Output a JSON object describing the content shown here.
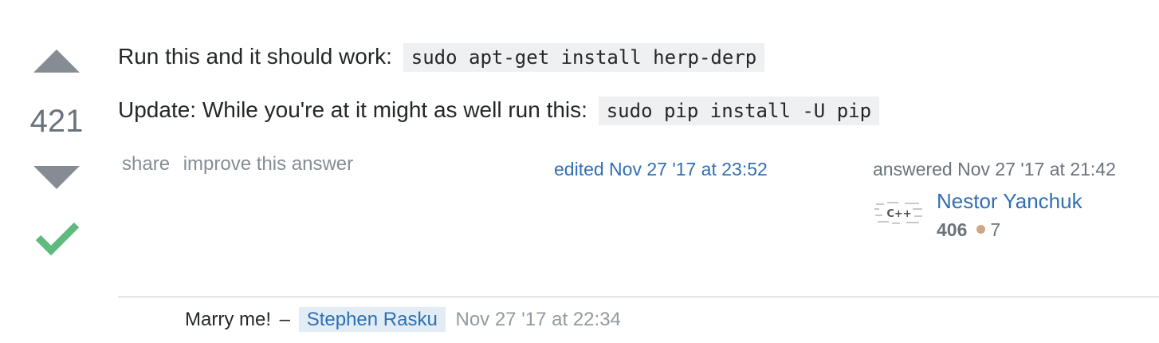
{
  "vote": {
    "count": "421",
    "up_icon": "triangle-up-icon",
    "down_icon": "triangle-down-icon",
    "accepted_icon": "checkmark-icon",
    "accepted_color": "#5fba7d"
  },
  "post": {
    "line1_text": "Run this and it should work:",
    "line1_code": "sudo apt-get install herp-derp",
    "line2_text": "Update: While you're at it might as well run this:",
    "line2_code": "sudo pip install -U pip"
  },
  "menu": {
    "share_label": "share",
    "improve_label": "improve this answer"
  },
  "edited": {
    "label": "edited Nov 27 '17 at 23:52"
  },
  "user": {
    "action": "answered Nov 27 '17 at 21:42",
    "avatar_text": "C++",
    "name": "Nestor Yanchuk",
    "reputation": "406",
    "bronze_badges": "7",
    "bronze_color": "#d1a684"
  },
  "comment": {
    "text": "Marry me!",
    "separator": "–",
    "user": "Stephen Rasku",
    "date": "Nov 27 '17 at 22:34"
  },
  "colors": {
    "link": "#2f6fb5",
    "muted": "#848d95",
    "code_bg": "#eff0f1"
  }
}
